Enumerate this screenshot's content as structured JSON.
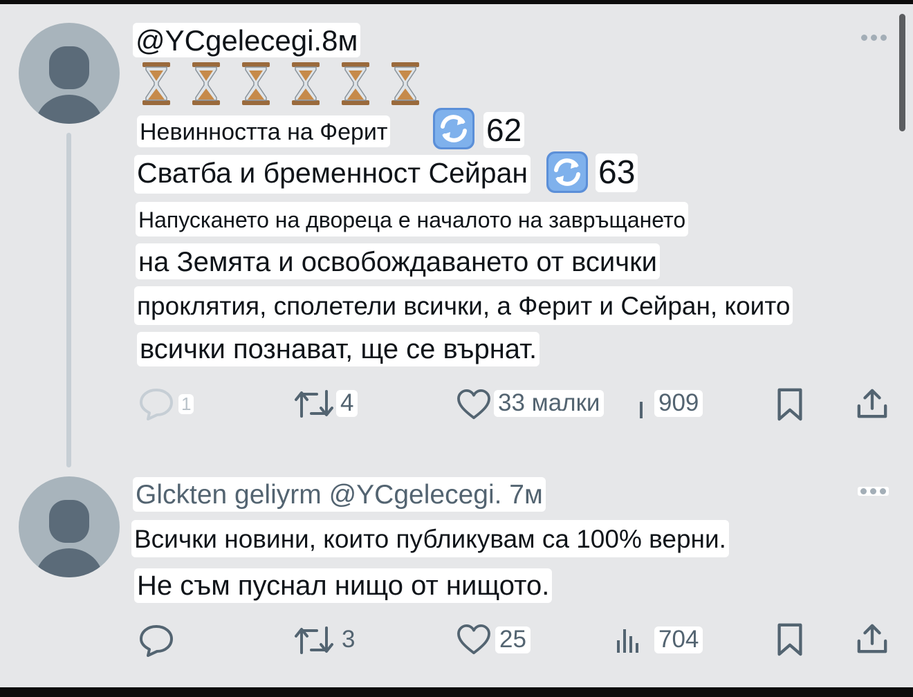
{
  "colors": {
    "background": "#e6e7e9",
    "text": "#0f1419",
    "secondary": "#536471",
    "avatar": "#a8b4bc",
    "hourglass_sand": "#c68a4a"
  },
  "posts": [
    {
      "header": "@YCgelecegi.8м",
      "emoji_icons": [
        "hourglass-icon",
        "hourglass-icon",
        "hourglass-icon",
        "hourglass-icon",
        "hourglass-icon",
        "hourglass-icon"
      ],
      "lines": [
        {
          "text": "Невинността на Ферит",
          "icon": "sync-icon",
          "number": "62"
        },
        {
          "text": "Сватба и бременност Сейран",
          "icon": "sync-icon",
          "number": "63"
        },
        {
          "text": "Напускането на двореца е началото на завръщането"
        },
        {
          "text": "на Земята и освобождаването от всички"
        },
        {
          "text": "проклятия, сполетели всички, а Ферит и Сейран, които"
        },
        {
          "text": "всички познават, ще се върнат."
        }
      ],
      "actions": {
        "replies": "1",
        "reposts": "4",
        "likes": "33 малки",
        "views": "909"
      }
    },
    {
      "header": "Glckten geliyrm @YCgelecegi. 7м",
      "lines": [
        {
          "text": "Всички новини, които публикувам са 100% верни."
        },
        {
          "text": "Не съм пуснал нищо от нищото."
        }
      ],
      "actions": {
        "reposts": "3",
        "likes": "25",
        "views": "704"
      }
    }
  ]
}
